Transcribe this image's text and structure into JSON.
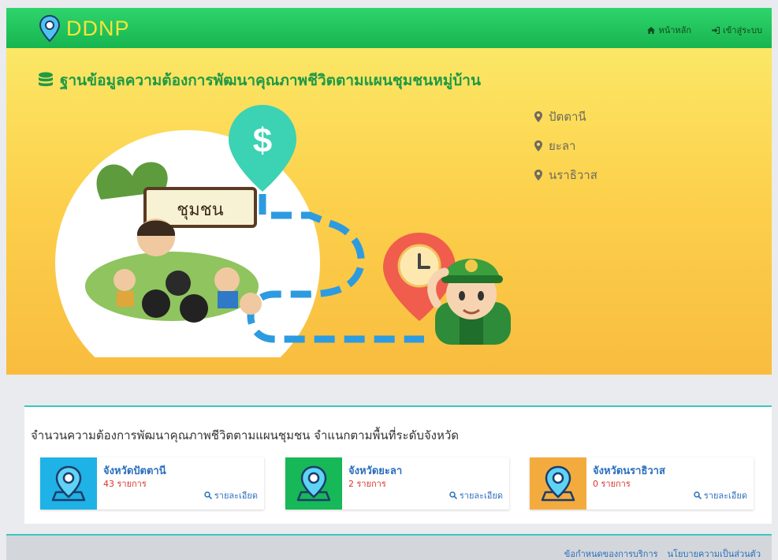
{
  "navbar": {
    "brand": "DDNP",
    "links": [
      {
        "label": "หน้าหลัก",
        "icon": "home-icon"
      },
      {
        "label": "เข้าสู่ระบบ",
        "icon": "sign-in-icon"
      }
    ]
  },
  "hero": {
    "title": "ฐานข้อมูลความต้องการพัฒนาคุณภาพชีวิตตามแผนชุมชนหมู่บ้าน",
    "title_icon": "database-icon",
    "illustration_sign": "ชุมชน",
    "provinces": [
      "ปัตตานี",
      "ยะลา",
      "นราธิวาส"
    ]
  },
  "summary": {
    "title": "จำนวนความต้องการพัฒนาคุณภาพชีวิตตามแผนชุมชน จำแนกตามพื้นที่ระดับจังหวัด",
    "cards": [
      {
        "name": "จังหวัดปัตตานี",
        "count": "43 รายการ",
        "link": "รายละเอียด",
        "color": "#1fb2e6"
      },
      {
        "name": "จังหวัดยะลา",
        "count": "2 รายการ",
        "link": "รายละเอียด",
        "color": "#17b857"
      },
      {
        "name": "จังหวัดนราธิวาส",
        "count": "0 รายการ",
        "link": "รายละเอียด",
        "color": "#f4ab3e"
      }
    ]
  },
  "footer": {
    "links": [
      "ข้อกำหนดของการบริการ",
      "นโยบายความเป็นส่วนตัว"
    ]
  },
  "colors": {
    "navbar_green": "#17b54f",
    "brand_yellow": "#f7e43a",
    "hero_yellow": "#fcd14c",
    "title_green": "#1e9a45",
    "accent_teal": "#3cc7c1"
  }
}
